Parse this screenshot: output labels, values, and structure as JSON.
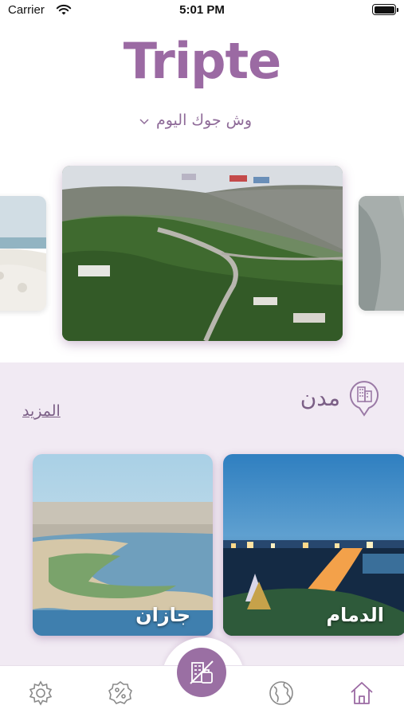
{
  "status_bar": {
    "carrier": "Carrier",
    "time": "5:01 PM"
  },
  "header": {
    "title": "Tripte",
    "mood_label": "وش جوك اليوم",
    "mood_icon": "chevron-down-icon"
  },
  "carousel": {
    "slides": [
      {
        "position": "left",
        "image": "coastal-beach-photo"
      },
      {
        "position": "center",
        "image": "mountain-valley-road-photo"
      },
      {
        "position": "right",
        "image": "rocky-cliff-photo"
      }
    ]
  },
  "cities": {
    "title": "مدن",
    "icon": "city-pin-icon",
    "more_label": "المزيد",
    "items": [
      {
        "name": "جازان",
        "image": "jazan-corniche-photo"
      },
      {
        "name": "الدمام",
        "image": "dammam-night-photo"
      }
    ]
  },
  "tab_bar": {
    "items": [
      {
        "name": "settings",
        "icon": "gear-icon"
      },
      {
        "name": "offers",
        "icon": "discount-badge-icon"
      },
      {
        "name": "plan",
        "icon": "hotel-suitcase-icon"
      },
      {
        "name": "explore",
        "icon": "globe-icon"
      },
      {
        "name": "home",
        "icon": "home-icon"
      }
    ]
  },
  "colors": {
    "brand": "#9b6aa3",
    "section_bg": "#f1eaf3",
    "text_accent": "#7b5f86"
  }
}
